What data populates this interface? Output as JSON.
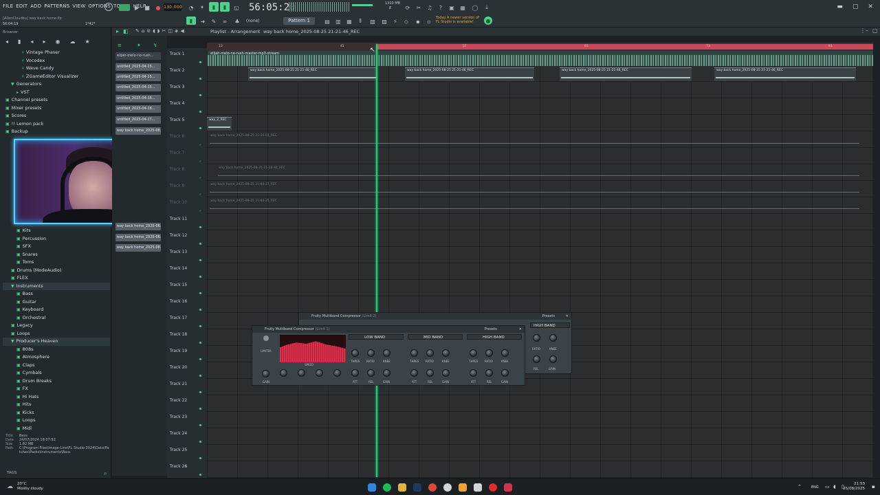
{
  "menu": [
    "FILE",
    "EDIT",
    "ADD",
    "PATTERNS",
    "VIEW",
    "OPTIONS",
    "TOOLS",
    "HELP"
  ],
  "project_info": {
    "title": "[AllenCloudbu] way back home.flp",
    "time": "56:04:19",
    "position": "1*42*"
  },
  "transport": {
    "tempo": "130.000",
    "time": "56:05:20",
    "cpu": "1310 MB",
    "polyphony": "8",
    "snap": "(none)",
    "pattern": "Pattern 1"
  },
  "update_notice": {
    "line1": "Today  A newer version of",
    "line2": "FL Studio is available!"
  },
  "playlist_title": "Playlist - Arrangement",
  "playlist_arrangement": "way back home_2025-08-25 21-21-46_REC",
  "browser": {
    "label": "Browser",
    "items": [
      {
        "label": "Vintage Phaser",
        "indent": 2,
        "kind": "item"
      },
      {
        "label": "Vocodex",
        "indent": 2,
        "kind": "item"
      },
      {
        "label": "Wave Candy",
        "indent": 2,
        "kind": "item"
      },
      {
        "label": "ZGameEditor Visualizer",
        "indent": 2,
        "kind": "item"
      },
      {
        "label": "Generators",
        "indent": 1,
        "kind": "folder"
      },
      {
        "label": "VST",
        "indent": 1,
        "kind": "folder"
      },
      {
        "label": "Channel presets",
        "indent": 0,
        "kind": "folder"
      },
      {
        "label": "Mixer presets",
        "indent": 0,
        "kind": "folder"
      },
      {
        "label": "Scores",
        "indent": 0,
        "kind": "folder"
      },
      {
        "label": "!! Lemon pack",
        "indent": 0,
        "kind": "folder"
      },
      {
        "label": "Backup",
        "indent": 0,
        "kind": "folder"
      }
    ],
    "items_lower": [
      {
        "label": "Kits",
        "indent": 2,
        "kind": "folder"
      },
      {
        "label": "Percussion",
        "indent": 2,
        "kind": "folder"
      },
      {
        "label": "SFX",
        "indent": 2,
        "kind": "folder"
      },
      {
        "label": "Snares",
        "indent": 2,
        "kind": "folder"
      },
      {
        "label": "Toms",
        "indent": 2,
        "kind": "folder"
      },
      {
        "label": "Drums (ModeAudio)",
        "indent": 1,
        "kind": "folder"
      },
      {
        "label": "FLEX",
        "indent": 1,
        "kind": "folder"
      },
      {
        "label": "Instruments",
        "indent": 1,
        "kind": "folder",
        "selected": true
      },
      {
        "label": "Bass",
        "indent": 2,
        "kind": "folder"
      },
      {
        "label": "Guitar",
        "indent": 2,
        "kind": "folder"
      },
      {
        "label": "Keyboard",
        "indent": 2,
        "kind": "folder"
      },
      {
        "label": "Orchestral",
        "indent": 2,
        "kind": "folder"
      },
      {
        "label": "Legacy",
        "indent": 1,
        "kind": "folder"
      },
      {
        "label": "Loops",
        "indent": 1,
        "kind": "folder"
      },
      {
        "label": "Producer's Heaven",
        "indent": 1,
        "kind": "folder",
        "selected": true
      },
      {
        "label": "808s",
        "indent": 2,
        "kind": "folder"
      },
      {
        "label": "Atmosphere",
        "indent": 2,
        "kind": "folder"
      },
      {
        "label": "Claps",
        "indent": 2,
        "kind": "folder"
      },
      {
        "label": "Cymbals",
        "indent": 2,
        "kind": "folder"
      },
      {
        "label": "Drum Breaks",
        "indent": 2,
        "kind": "folder"
      },
      {
        "label": "FX",
        "indent": 2,
        "kind": "folder"
      },
      {
        "label": "Hi Hats",
        "indent": 2,
        "kind": "folder"
      },
      {
        "label": "Hits",
        "indent": 2,
        "kind": "folder"
      },
      {
        "label": "Kicks",
        "indent": 2,
        "kind": "folder"
      },
      {
        "label": "Loops",
        "indent": 2,
        "kind": "folder"
      },
      {
        "label": "Midi",
        "indent": 2,
        "kind": "folder"
      }
    ],
    "info": {
      "title_k": "Title",
      "title_v": "Bass",
      "date_k": "Date",
      "date_v": "24/07/2024 18:07:52",
      "size_k": "Size",
      "size_v": "1.82 MB",
      "path_k": "Path",
      "path_v1": "C:\\Program Files\\Image-Line\\FL Studio 2024\\Data\\Pa",
      "path_v2": "tches\\Packs\\Instruments\\Bass"
    },
    "tags_label": "TAGS"
  },
  "picker": [
    "elijah-melo-no-rush...",
    "untitled_2025-04-15...",
    "untitled_2025-04-15...",
    "untitled_2025-04-15...",
    "untitled_2025-04-16...",
    "untitled_2025-04-16...",
    "untitled_2025-04-17...",
    "way back home_2025-08...",
    "way back home_2025-08...",
    "way back home_2025-08...",
    "way back home_2025-08..."
  ],
  "tracks": [
    "Track 1",
    "Track 2",
    "Track 3",
    "Track 4",
    "Track 5",
    "Track 6",
    "Track 7",
    "Track 8",
    "Track 9",
    "Track 10",
    "Track 11",
    "Track 12",
    "Track 13",
    "Track 14",
    "Track 15",
    "Track 16",
    "Track 17",
    "Track 18",
    "Track 19",
    "Track 20",
    "Track 21",
    "Track 22",
    "Track 23",
    "Track 24",
    "Track 25",
    "Track 26"
  ],
  "timeline_marks": [
    "13",
    "41",
    "57",
    "65",
    "73",
    "81"
  ],
  "clips": {
    "main": "elijah-melo-no-rush-master-mp3-stream",
    "rec": [
      "way back home_2025-08-25 21-21-46_REC",
      "way back home_2025-08-25 21-21-46_REC",
      "way back home_2025-08-25 21-21-46_REC",
      "way back home_2025-08-25 21-21-46_REC"
    ],
    "small": "way_2_REC",
    "muted": [
      "way back home_2025-08-25 21-16-01_REC",
      "way back home_2025-08-25 21-18-40_REC",
      "way back home_2025-08-25 21-44-27_REC",
      "way back home_2025-08-25 21-44-25_REC"
    ]
  },
  "plugin_front": {
    "title": "Fruity Multiband Compressor",
    "subtitle": "(Limit 1)",
    "presets": "Presets",
    "limiter": "LIMITER",
    "bands": [
      "LOW BAND",
      "MID BAND",
      "HIGH BAND"
    ],
    "knob_labels_top": [
      "THRES",
      "RATIO",
      "KNEE"
    ],
    "knob_labels_bottom": [
      "ATT",
      "REL",
      "GAIN"
    ],
    "gain": "GAIN",
    "speed": "SPEED"
  },
  "plugin_back": {
    "title": "Fruity Multiband Compressor",
    "subtitle": "(Limit 2)",
    "presets": "Presets",
    "band": "HIGH BAND",
    "knob_labels": [
      "RATIO",
      "KNEE",
      "REL",
      "GAIN"
    ]
  },
  "taskbar": {
    "temp": "20°C",
    "weather": "Mostly cloudy",
    "lang": "ENG",
    "time": "21:53",
    "date": "25/08/2025"
  },
  "colors": {
    "accent": "#4fd08e",
    "playhead": "#1fcf7a",
    "loop": "#c9485a",
    "webcam_border": "#55d6ff"
  }
}
